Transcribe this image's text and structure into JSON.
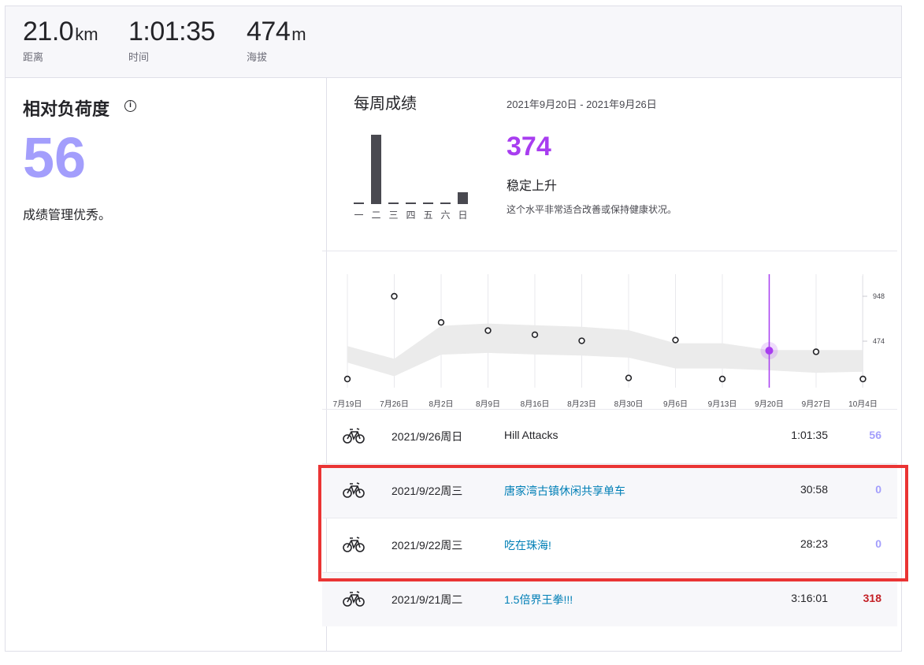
{
  "stats": [
    {
      "value": "21.0",
      "unit": "km",
      "label": "距离"
    },
    {
      "value": "1:01:35",
      "unit": "",
      "label": "时间"
    },
    {
      "value": "474",
      "unit": "m",
      "label": "海拔"
    }
  ],
  "relative_effort": {
    "title": "相对负荷度",
    "info_icon": "i",
    "score": "56",
    "description": "成绩管理优秀。"
  },
  "weekly": {
    "title": "每周成绩",
    "date_range": "2021年9月20日 - 2021年9月26日",
    "score": "374",
    "status": "稳定上升",
    "note": "这个水平非常适合改善或保持健康状况。",
    "days": [
      "一",
      "二",
      "三",
      "四",
      "五",
      "六",
      "日"
    ],
    "day_values": [
      0,
      318,
      0,
      0,
      0,
      0,
      56
    ]
  },
  "trend": {
    "weeks": [
      "7月19日",
      "7月26日",
      "8月2日",
      "8月9日",
      "8月16日",
      "8月23日",
      "8月30日",
      "9月6日",
      "9月13日",
      "9月20日",
      "9月27日",
      "10月4日"
    ],
    "y_tick_labels": [
      "948",
      "474"
    ],
    "y_ticks": [
      948,
      474
    ],
    "values": [
      0,
      948,
      672,
      586,
      542,
      478,
      86,
      486,
      66,
      374,
      362,
      0
    ],
    "band_low": [
      248,
      104,
      332,
      350,
      334,
      322,
      300,
      186,
      186,
      166,
      140,
      152
    ],
    "band_high": [
      422,
      288,
      636,
      660,
      642,
      626,
      590,
      452,
      452,
      380,
      380,
      380
    ],
    "selected_index": 9,
    "colors": {
      "band": "#ebebeb",
      "selected": "#a83df0",
      "grid": "#e8e8ec"
    }
  },
  "activities": [
    {
      "icon": "bike-icon",
      "date": "2021/9/26周日",
      "name": "Hill Attacks",
      "time": "1:01:35",
      "effort": "56",
      "effort_color": "#a39efc",
      "link": false
    },
    {
      "icon": "bike-icon",
      "date": "2021/9/22周三",
      "name": "唐家湾古镇休闲共享单车",
      "time": "30:58",
      "effort": "0",
      "effort_color": "#a39efc",
      "link": true
    },
    {
      "icon": "bike-icon",
      "date": "2021/9/22周三",
      "name": "吃在珠海!",
      "time": "28:23",
      "effort": "0",
      "effort_color": "#a39efc",
      "link": true
    },
    {
      "icon": "bike-icon",
      "date": "2021/9/21周二",
      "name": "1.5倍界王拳!!!",
      "time": "3:16:01",
      "effort": "318",
      "effort_color": "#c42127",
      "link": true
    }
  ],
  "colors": {
    "accent": "#a83df0",
    "effort_light": "#a39efc",
    "link": "#007fb6",
    "highlight": "#ea3434"
  }
}
